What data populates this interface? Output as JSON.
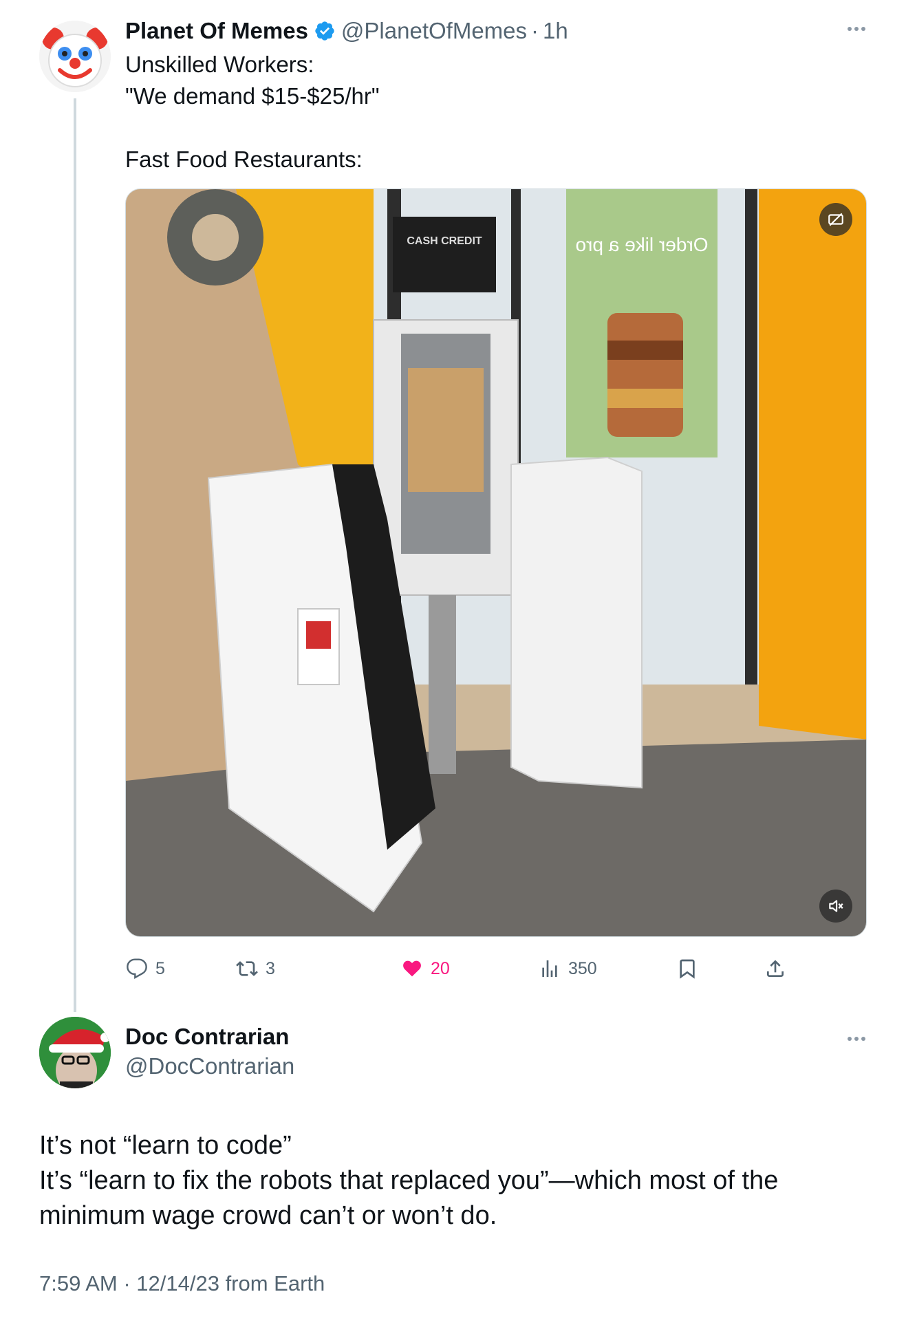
{
  "parent_tweet": {
    "display_name": "Planet Of Memes",
    "handle": "@PlanetOfMemes",
    "separator": "·",
    "time": "1h",
    "text_lines": [
      "Unskilled Workers:",
      "\"We demand $15-$25/hr\"",
      "",
      "Fast Food Restaurants:"
    ],
    "media_overlay_text": "Order like a pro",
    "media_kiosk_text": "CASH  CREDIT",
    "stats": {
      "replies": "5",
      "retweets": "3",
      "likes": "20",
      "views": "350"
    },
    "liked": true
  },
  "reply_tweet": {
    "display_name": "Doc Contrarian",
    "handle": "@DocContrarian",
    "text_lines": [
      "It’s not “learn to code”",
      "It’s “learn to fix the robots that replaced you”—which most of the",
      "minimum wage crowd can’t or won’t do."
    ],
    "meta": "7:59 AM · 12/14/23 from Earth"
  },
  "colors": {
    "verified_blue": "#1d9bf0",
    "like_pink": "#f91880",
    "secondary_text": "#536471",
    "thread_line": "#cfd9de"
  },
  "icons": [
    "more-icon",
    "verified-badge-icon",
    "reply-icon",
    "retweet-icon",
    "like-icon",
    "views-icon",
    "bookmark-icon",
    "share-icon",
    "muted-speaker-icon",
    "no-audio-icon"
  ]
}
